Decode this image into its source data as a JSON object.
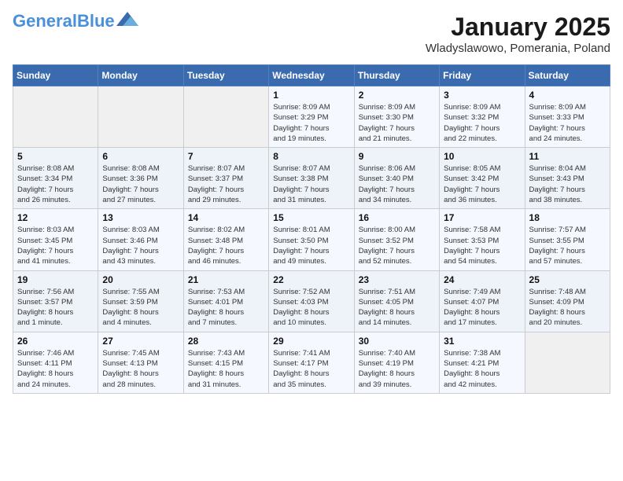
{
  "header": {
    "logo_general": "General",
    "logo_blue": "Blue",
    "month": "January 2025",
    "location": "Wladyslawowo, Pomerania, Poland"
  },
  "weekdays": [
    "Sunday",
    "Monday",
    "Tuesday",
    "Wednesday",
    "Thursday",
    "Friday",
    "Saturday"
  ],
  "weeks": [
    [
      {
        "day": "",
        "content": ""
      },
      {
        "day": "",
        "content": ""
      },
      {
        "day": "",
        "content": ""
      },
      {
        "day": "1",
        "content": "Sunrise: 8:09 AM\nSunset: 3:29 PM\nDaylight: 7 hours\nand 19 minutes."
      },
      {
        "day": "2",
        "content": "Sunrise: 8:09 AM\nSunset: 3:30 PM\nDaylight: 7 hours\nand 21 minutes."
      },
      {
        "day": "3",
        "content": "Sunrise: 8:09 AM\nSunset: 3:32 PM\nDaylight: 7 hours\nand 22 minutes."
      },
      {
        "day": "4",
        "content": "Sunrise: 8:09 AM\nSunset: 3:33 PM\nDaylight: 7 hours\nand 24 minutes."
      }
    ],
    [
      {
        "day": "5",
        "content": "Sunrise: 8:08 AM\nSunset: 3:34 PM\nDaylight: 7 hours\nand 26 minutes."
      },
      {
        "day": "6",
        "content": "Sunrise: 8:08 AM\nSunset: 3:36 PM\nDaylight: 7 hours\nand 27 minutes."
      },
      {
        "day": "7",
        "content": "Sunrise: 8:07 AM\nSunset: 3:37 PM\nDaylight: 7 hours\nand 29 minutes."
      },
      {
        "day": "8",
        "content": "Sunrise: 8:07 AM\nSunset: 3:38 PM\nDaylight: 7 hours\nand 31 minutes."
      },
      {
        "day": "9",
        "content": "Sunrise: 8:06 AM\nSunset: 3:40 PM\nDaylight: 7 hours\nand 34 minutes."
      },
      {
        "day": "10",
        "content": "Sunrise: 8:05 AM\nSunset: 3:42 PM\nDaylight: 7 hours\nand 36 minutes."
      },
      {
        "day": "11",
        "content": "Sunrise: 8:04 AM\nSunset: 3:43 PM\nDaylight: 7 hours\nand 38 minutes."
      }
    ],
    [
      {
        "day": "12",
        "content": "Sunrise: 8:03 AM\nSunset: 3:45 PM\nDaylight: 7 hours\nand 41 minutes."
      },
      {
        "day": "13",
        "content": "Sunrise: 8:03 AM\nSunset: 3:46 PM\nDaylight: 7 hours\nand 43 minutes."
      },
      {
        "day": "14",
        "content": "Sunrise: 8:02 AM\nSunset: 3:48 PM\nDaylight: 7 hours\nand 46 minutes."
      },
      {
        "day": "15",
        "content": "Sunrise: 8:01 AM\nSunset: 3:50 PM\nDaylight: 7 hours\nand 49 minutes."
      },
      {
        "day": "16",
        "content": "Sunrise: 8:00 AM\nSunset: 3:52 PM\nDaylight: 7 hours\nand 52 minutes."
      },
      {
        "day": "17",
        "content": "Sunrise: 7:58 AM\nSunset: 3:53 PM\nDaylight: 7 hours\nand 54 minutes."
      },
      {
        "day": "18",
        "content": "Sunrise: 7:57 AM\nSunset: 3:55 PM\nDaylight: 7 hours\nand 57 minutes."
      }
    ],
    [
      {
        "day": "19",
        "content": "Sunrise: 7:56 AM\nSunset: 3:57 PM\nDaylight: 8 hours\nand 1 minute."
      },
      {
        "day": "20",
        "content": "Sunrise: 7:55 AM\nSunset: 3:59 PM\nDaylight: 8 hours\nand 4 minutes."
      },
      {
        "day": "21",
        "content": "Sunrise: 7:53 AM\nSunset: 4:01 PM\nDaylight: 8 hours\nand 7 minutes."
      },
      {
        "day": "22",
        "content": "Sunrise: 7:52 AM\nSunset: 4:03 PM\nDaylight: 8 hours\nand 10 minutes."
      },
      {
        "day": "23",
        "content": "Sunrise: 7:51 AM\nSunset: 4:05 PM\nDaylight: 8 hours\nand 14 minutes."
      },
      {
        "day": "24",
        "content": "Sunrise: 7:49 AM\nSunset: 4:07 PM\nDaylight: 8 hours\nand 17 minutes."
      },
      {
        "day": "25",
        "content": "Sunrise: 7:48 AM\nSunset: 4:09 PM\nDaylight: 8 hours\nand 20 minutes."
      }
    ],
    [
      {
        "day": "26",
        "content": "Sunrise: 7:46 AM\nSunset: 4:11 PM\nDaylight: 8 hours\nand 24 minutes."
      },
      {
        "day": "27",
        "content": "Sunrise: 7:45 AM\nSunset: 4:13 PM\nDaylight: 8 hours\nand 28 minutes."
      },
      {
        "day": "28",
        "content": "Sunrise: 7:43 AM\nSunset: 4:15 PM\nDaylight: 8 hours\nand 31 minutes."
      },
      {
        "day": "29",
        "content": "Sunrise: 7:41 AM\nSunset: 4:17 PM\nDaylight: 8 hours\nand 35 minutes."
      },
      {
        "day": "30",
        "content": "Sunrise: 7:40 AM\nSunset: 4:19 PM\nDaylight: 8 hours\nand 39 minutes."
      },
      {
        "day": "31",
        "content": "Sunrise: 7:38 AM\nSunset: 4:21 PM\nDaylight: 8 hours\nand 42 minutes."
      },
      {
        "day": "",
        "content": ""
      }
    ]
  ]
}
